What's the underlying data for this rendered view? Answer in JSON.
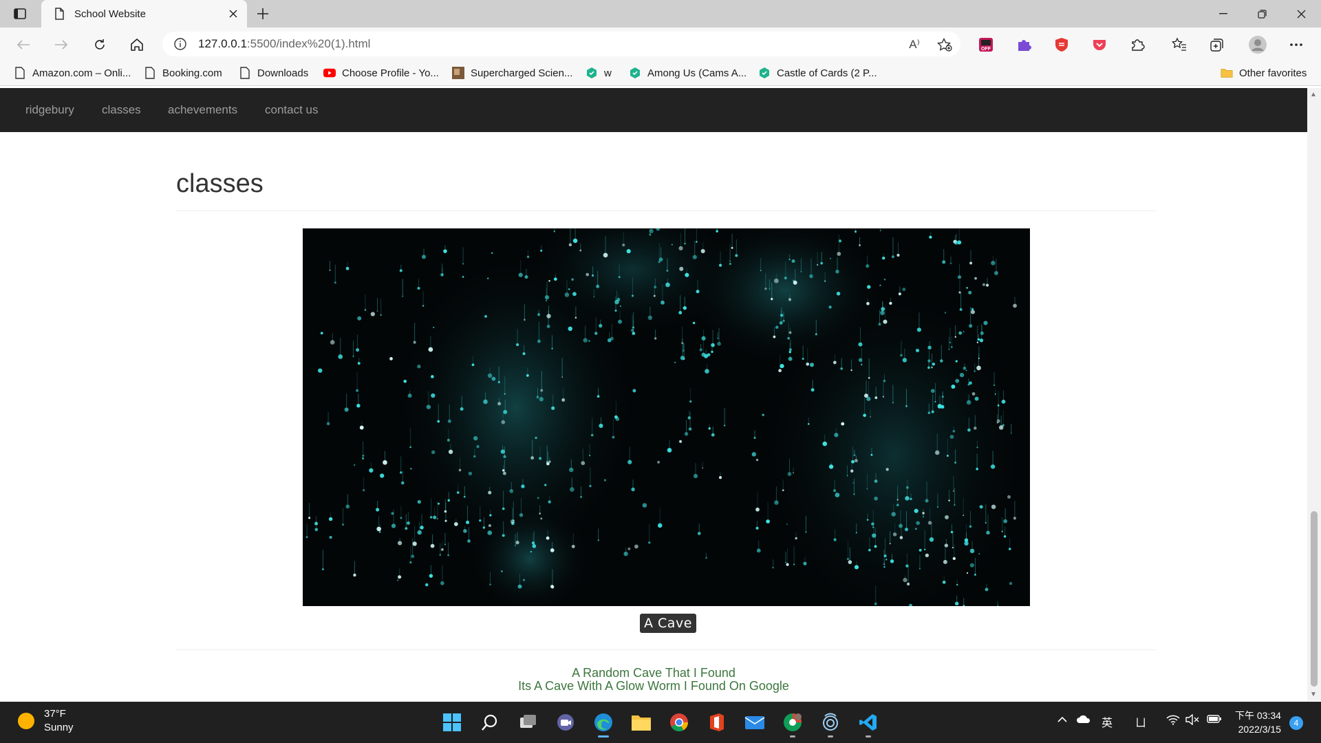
{
  "browser": {
    "tab_title": "School Website",
    "url_host": "127.0.0.1",
    "url_path": ":5500/index%20(1).html",
    "read_aloud_label": "A⁾"
  },
  "favorites": [
    {
      "label": "Amazon.com – Onli...",
      "icon": "page-icon"
    },
    {
      "label": "Booking.com",
      "icon": "page-icon"
    },
    {
      "label": "Downloads",
      "icon": "page-icon"
    },
    {
      "label": "Choose Profile - Yo...",
      "icon": "youtube-icon"
    },
    {
      "label": "Supercharged Scien...",
      "icon": "thumbnail-icon"
    },
    {
      "label": "w",
      "icon": "hex-icon"
    },
    {
      "label": "Among Us (Cams A...",
      "icon": "hex-icon"
    },
    {
      "label": "Castle of Cards (2 P...",
      "icon": "hex-icon"
    }
  ],
  "other_favorites": "Other favorites",
  "site": {
    "nav": [
      "ridgebury",
      "classes",
      "achevements",
      "contact us"
    ],
    "heading": "classes",
    "caption": "A Cave",
    "description_line1": "A Random Cave That I Found",
    "description_line2": "Its A Cave With A Glow Worm I Found On Google"
  },
  "taskbar": {
    "temperature": "37°F",
    "condition": "Sunny",
    "ime": "英",
    "ime2": "ㄩ",
    "time": "下午 03:34",
    "date": "2022/3/15",
    "notifications": "4"
  },
  "colors": {
    "navbar": "#222222",
    "nav_text": "#9d9d9d",
    "description": "#3c763d",
    "glow": "#3fe6e6"
  }
}
